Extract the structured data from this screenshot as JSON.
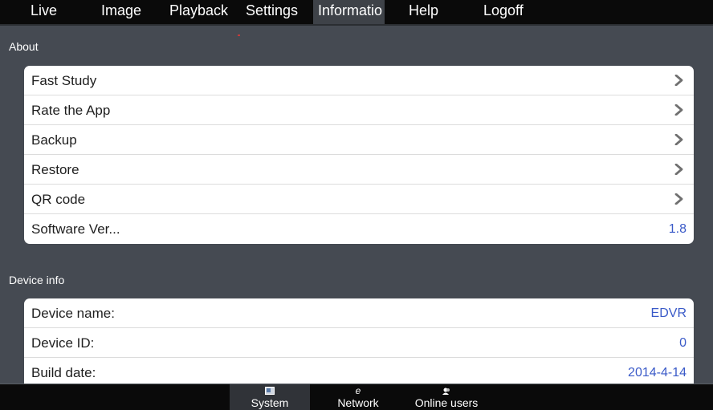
{
  "nav": {
    "tabs": [
      {
        "label": "Live"
      },
      {
        "label": "Image"
      },
      {
        "label": "Playback"
      },
      {
        "label": "Settings"
      },
      {
        "label": "Informatio"
      },
      {
        "label": "Help"
      },
      {
        "label": "Logoff"
      }
    ]
  },
  "about": {
    "title": "About",
    "items": [
      {
        "label": "Fast Study"
      },
      {
        "label": "Rate the App"
      },
      {
        "label": "Backup"
      },
      {
        "label": "Restore"
      },
      {
        "label": "QR code"
      },
      {
        "label": "Software Ver...",
        "value": "1.8"
      }
    ]
  },
  "device": {
    "title": "Device info",
    "items": [
      {
        "label": "Device name:",
        "value": "EDVR"
      },
      {
        "label": "Device ID:",
        "value": "0"
      },
      {
        "label": "Build date:",
        "value": "2014-4-14"
      }
    ]
  },
  "bottom": {
    "tabs": [
      {
        "label": "System",
        "icon": "system-icon"
      },
      {
        "label": "Network",
        "icon": "network-icon"
      },
      {
        "label": "Online users",
        "icon": "users-icon"
      }
    ]
  },
  "colors": {
    "background": "#454a52",
    "bar": "#0a0a0a",
    "value_text": "#3a5ac8",
    "active_tab": "#3e4248"
  }
}
